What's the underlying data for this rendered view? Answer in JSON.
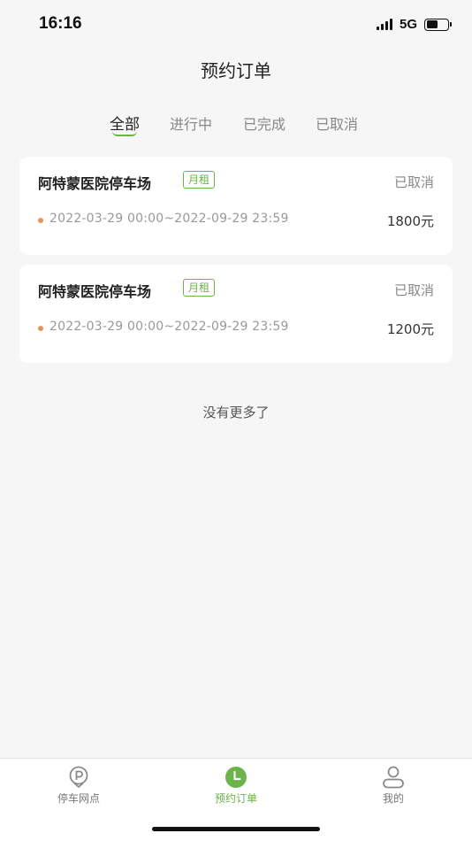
{
  "status_bar": {
    "time": "16:16",
    "network": "5G"
  },
  "header": {
    "title": "预约订单"
  },
  "tabs": [
    {
      "label": "全部",
      "active": true
    },
    {
      "label": "进行中",
      "active": false
    },
    {
      "label": "已完成",
      "active": false
    },
    {
      "label": "已取消",
      "active": false
    }
  ],
  "orders": [
    {
      "lot_name": "阿特蒙医院停车场",
      "type_badge": "月租",
      "status": "已取消",
      "period": "2022-03-29 00:00~2022-09-29 23:59",
      "price": "1800元"
    },
    {
      "lot_name": "阿特蒙医院停车场",
      "type_badge": "月租",
      "status": "已取消",
      "period": "2022-03-29 00:00~2022-09-29 23:59",
      "price": "1200元"
    }
  ],
  "list_footer": "没有更多了",
  "bottom_nav": [
    {
      "label": "停车网点",
      "icon": "parking-pin-icon",
      "active": false
    },
    {
      "label": "预约订单",
      "icon": "clock-icon",
      "active": true
    },
    {
      "label": "我的",
      "icon": "user-icon",
      "active": false
    }
  ],
  "colors": {
    "accent": "#6bb34a",
    "dot": "#e8925a",
    "background": "#f6f6f6"
  }
}
